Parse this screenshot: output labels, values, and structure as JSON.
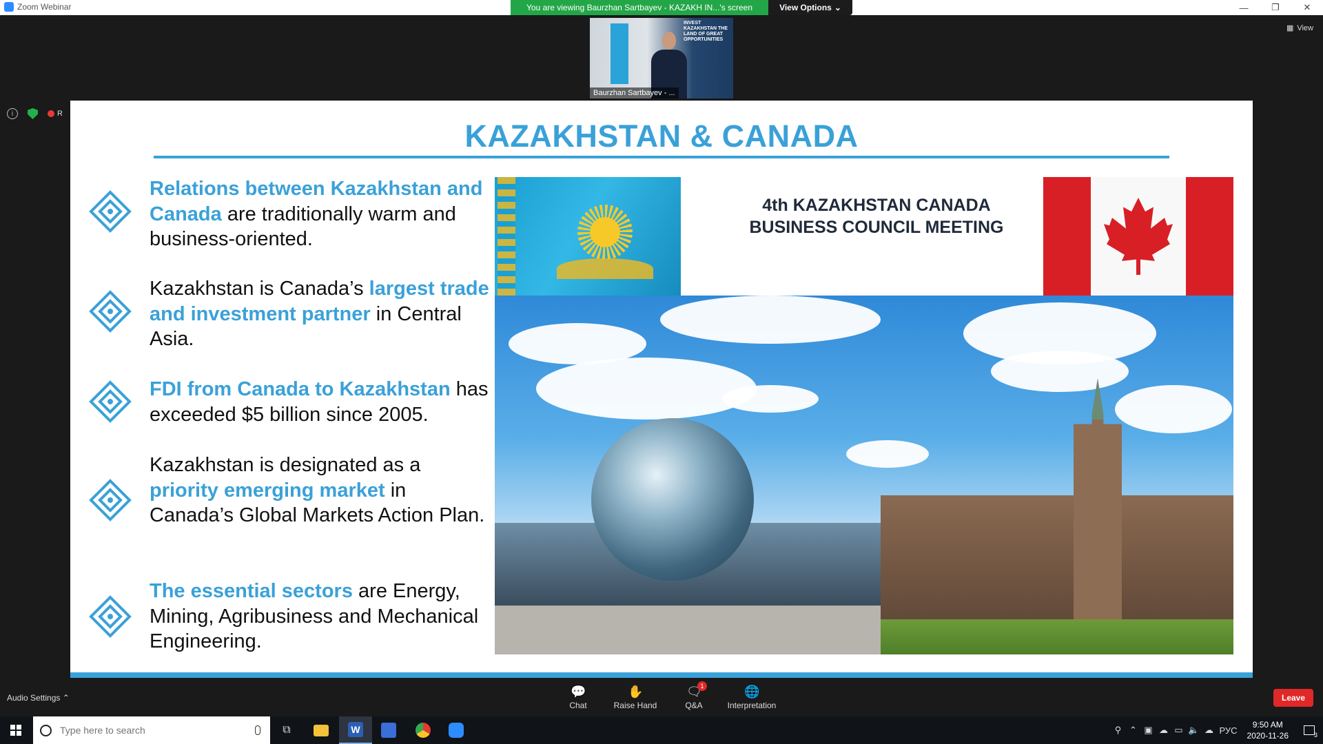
{
  "window": {
    "app_title": "Zoom Webinar",
    "controls": [
      "—",
      "❐",
      "✕"
    ]
  },
  "screen_share": {
    "banner_text": "You are viewing Baurzhan Sartbayev - KAZAKH IN...'s screen",
    "view_options_label": "View Options",
    "view_label": "View"
  },
  "video": {
    "participant_name": "Baurzhan Sartbayev - ...",
    "backdrop_text": "INVEST KAZAKHSTAN THE LAND OF GREAT OPPORTUNITIES"
  },
  "status": {
    "info_icon": "info-icon",
    "security_icon": "shield-icon",
    "recording_label": "R"
  },
  "slide": {
    "title": "KAZAKHSTAN & CANADA",
    "accent_color": "#3aa1d8",
    "bullets": [
      {
        "highlight": "Relations between Kazakhstan and Canada",
        "rest": " are traditionally warm and business-oriented."
      },
      {
        "pre": "Kazakhstan is Canada’s ",
        "highlight": "largest trade and investment partner",
        "rest": " in Central Asia."
      },
      {
        "highlight": "FDI from Canada to Kazakhstan",
        "rest": " has exceeded $5 billion since 2005."
      },
      {
        "pre": "Kazakhstan is designated as a ",
        "highlight": "priority emerging market",
        "rest": " in Canada’s Global Markets Action Plan."
      },
      {
        "highlight": "The essential sectors",
        "rest": " are Energy, Mining, Agribusiness and Mechanical Engineering."
      }
    ],
    "council_line1": "4th KAZAKHSTAN CANADA",
    "council_line2": "BUSINESS COUNCIL MEETING"
  },
  "toolbar": {
    "audio_settings_label": "Audio Settings",
    "chat_label": "Chat",
    "raise_hand_label": "Raise Hand",
    "qa_label": "Q&A",
    "qa_badge": "1",
    "interpretation_label": "Interpretation",
    "leave_label": "Leave",
    "leave_color": "#e02828"
  },
  "taskbar": {
    "search_placeholder": "Type here to search",
    "language": "РУС",
    "time": "9:50 AM",
    "date": "2020-11-26",
    "notification_count": "3",
    "apps": [
      "task-view-icon",
      "file-explorer-icon",
      "word-icon",
      "app-icon",
      "chrome-icon",
      "zoom-icon"
    ]
  }
}
